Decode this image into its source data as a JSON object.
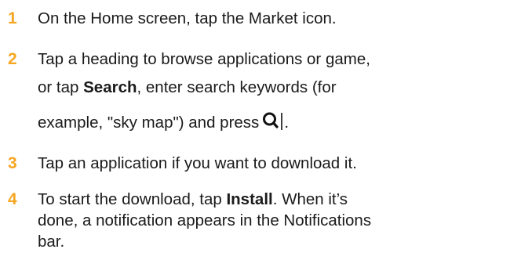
{
  "accent_color": "#f5a623",
  "steps": [
    {
      "number": "1",
      "text": "On the Home screen, tap the Market icon."
    },
    {
      "number": "2",
      "line1": "Tap a heading to browse applications or game,",
      "line2_pre": "or tap ",
      "line2_bold": "Search",
      "line2_post": ", enter search keywords (for",
      "line3_pre": "example, \"sky map\") and press",
      "line3_icon": "search-key-icon",
      "line3_post": "."
    },
    {
      "number": "3",
      "text": "Tap an application if you want to download it."
    },
    {
      "number": "4",
      "line1_pre": "To start the download, tap ",
      "line1_bold": "Install",
      "line1_post": ". When it’s",
      "line2": "done, a notification appears in the Notifications",
      "line3": "bar."
    }
  ]
}
